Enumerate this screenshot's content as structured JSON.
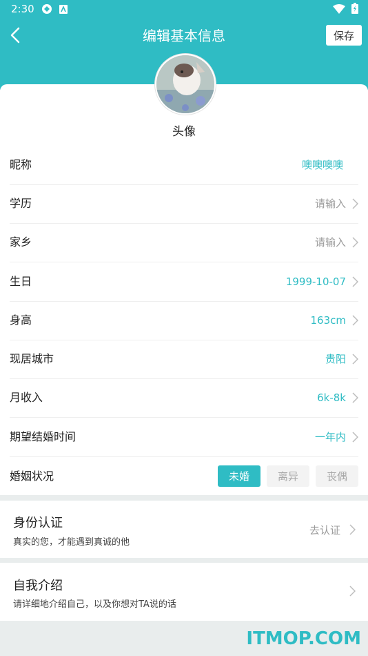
{
  "status_bar": {
    "time": "2:30"
  },
  "nav": {
    "title": "编辑基本信息",
    "save_label": "保存"
  },
  "avatar": {
    "label": "头像"
  },
  "fields": [
    {
      "label": "昵称",
      "value": "噢噢噢噢"
    },
    {
      "label": "学历",
      "value": "请输入"
    },
    {
      "label": "家乡",
      "value": "请输入"
    },
    {
      "label": "生日",
      "value": "1999-10-07"
    },
    {
      "label": "身高",
      "value": "163cm"
    },
    {
      "label": "现居城市",
      "value": "贵阳"
    },
    {
      "label": "月收入",
      "value": "6k-8k"
    },
    {
      "label": "期望结婚时间",
      "value": "一年内"
    }
  ],
  "marital": {
    "label": "婚姻状况",
    "options": [
      "未婚",
      "离异",
      "丧偶"
    ],
    "selected": "未婚"
  },
  "verification": {
    "title": "身份认证",
    "subtitle": "真实的您，才能遇到真诚的他",
    "action": "去认证"
  },
  "intro": {
    "title": "自我介绍",
    "subtitle": "请详细地介绍自己，以及你想对TA说的话"
  },
  "watermark": "ITMOP.COM",
  "colors": {
    "accent": "#2fbcc4",
    "background": "#e9eded",
    "placeholder": "#9c9c9c"
  }
}
